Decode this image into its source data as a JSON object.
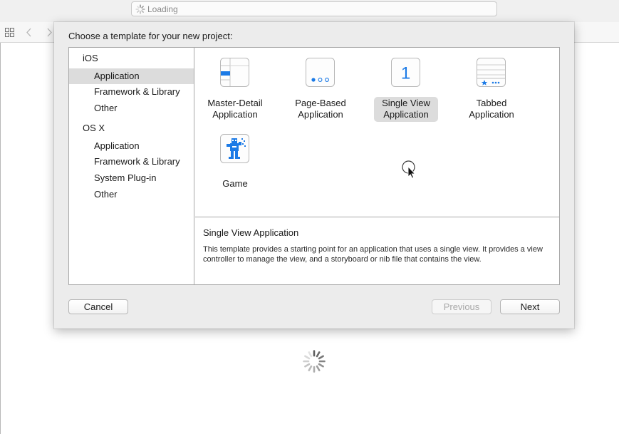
{
  "activity": {
    "status": "Loading"
  },
  "sheet": {
    "title": "Choose a template for your new project:",
    "sidebar": {
      "groups": [
        {
          "header": "iOS",
          "items": [
            "Application",
            "Framework & Library",
            "Other"
          ]
        },
        {
          "header": "OS X",
          "items": [
            "Application",
            "Framework & Library",
            "System Plug-in",
            "Other"
          ]
        }
      ],
      "selected": "iOS > Application"
    },
    "templates": [
      {
        "line1": "Master-Detail",
        "line2": "Application",
        "icon": "master-detail-icon"
      },
      {
        "line1": "Page-Based",
        "line2": "Application",
        "icon": "page-based-icon"
      },
      {
        "line1": "Single View",
        "line2": "Application",
        "icon": "single-view-icon",
        "icon_text": "1",
        "selected": true
      },
      {
        "line1": "Tabbed",
        "line2": "Application",
        "icon": "tabbed-icon"
      },
      {
        "line1": "Game",
        "line2": "",
        "icon": "game-icon"
      }
    ],
    "description": {
      "title": "Single View Application",
      "body": "This template provides a starting point for an application that uses a single view. It provides a view controller to manage the view, and a storyboard or nib file that contains the view."
    },
    "buttons": {
      "cancel": "Cancel",
      "previous": "Previous",
      "next": "Next"
    }
  },
  "colors": {
    "accent": "#1b7ae6",
    "selection": "#dcdcdc",
    "sheet_bg": "#ececec"
  }
}
